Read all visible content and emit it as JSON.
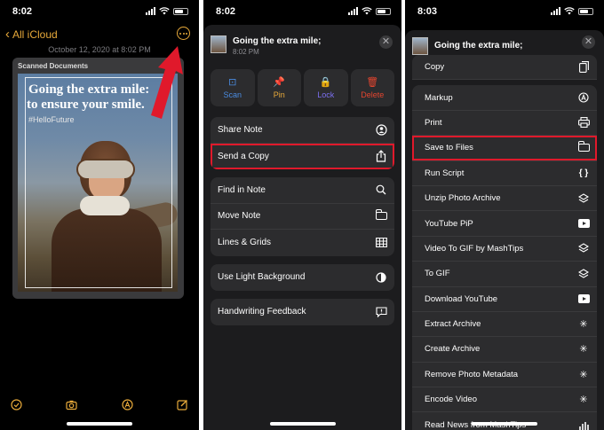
{
  "panel1": {
    "status_time": "8:02",
    "back_label": "All iCloud",
    "date_text": "October 12, 2020 at 8:02 PM",
    "scan_title": "Scanned Documents",
    "photo_line1": "Going  the extra mile:",
    "photo_line2": "to ensure your smile.",
    "photo_hashtag": "#HelloFuture",
    "toolbar_icons": [
      "checklist-icon",
      "camera-icon",
      "markup-icon",
      "compose-icon"
    ],
    "accent_color": "#e7a93a",
    "arrow_color": "#e0192b"
  },
  "panel2": {
    "status_time": "8:02",
    "sheet_title": "Going the extra mile;",
    "sheet_subtitle": "8:02 PM",
    "actions": [
      {
        "label": "Scan",
        "color": "#4a8be0",
        "icon": "scan-icon"
      },
      {
        "label": "Pin",
        "color": "#e7a93a",
        "icon": "pin-icon"
      },
      {
        "label": "Lock",
        "color": "#7b6ff0",
        "icon": "lock-icon"
      },
      {
        "label": "Delete",
        "color": "#e3452f",
        "icon": "trash-icon"
      }
    ],
    "group1": [
      {
        "label": "Share Note",
        "icon": "share-note-icon"
      },
      {
        "label": "Send a Copy",
        "icon": "share-icon",
        "highlighted": true
      }
    ],
    "group2": [
      {
        "label": "Find in Note",
        "icon": "search-icon"
      },
      {
        "label": "Move Note",
        "icon": "folder-icon"
      },
      {
        "label": "Lines & Grids",
        "icon": "grid-icon"
      }
    ],
    "group3": [
      {
        "label": "Use Light Background",
        "icon": "contrast-icon"
      }
    ],
    "group4": [
      {
        "label": "Handwriting Feedback",
        "icon": "feedback-icon"
      }
    ]
  },
  "panel3": {
    "status_time": "8:03",
    "sheet_title": "Going the extra mile;",
    "rows": [
      {
        "label": "Copy",
        "icon": "copy-icon"
      },
      {
        "label": "Markup",
        "icon": "markup-icon",
        "separator": true
      },
      {
        "label": "Print",
        "icon": "print-icon"
      },
      {
        "label": "Save to Files",
        "icon": "folder-icon",
        "highlighted": true
      },
      {
        "label": "Run Script",
        "icon": "braces-icon"
      },
      {
        "label": "Unzip Photo Archive",
        "icon": "layers-icon"
      },
      {
        "label": "YouTube PiP",
        "icon": "play-icon"
      },
      {
        "label": "Video To GIF by MashTips",
        "icon": "layers-icon"
      },
      {
        "label": "To GIF",
        "icon": "layers-icon"
      },
      {
        "label": "Download YouTube",
        "icon": "play-icon"
      },
      {
        "label": "Extract Archive",
        "icon": "spinner-icon"
      },
      {
        "label": "Create Archive",
        "icon": "spinner-icon"
      },
      {
        "label": "Remove Photo Metadata",
        "icon": "spinner-icon"
      },
      {
        "label": "Encode Video",
        "icon": "spinner-icon"
      },
      {
        "label": "Read News from MashTips",
        "icon": "chart-icon"
      }
    ]
  }
}
